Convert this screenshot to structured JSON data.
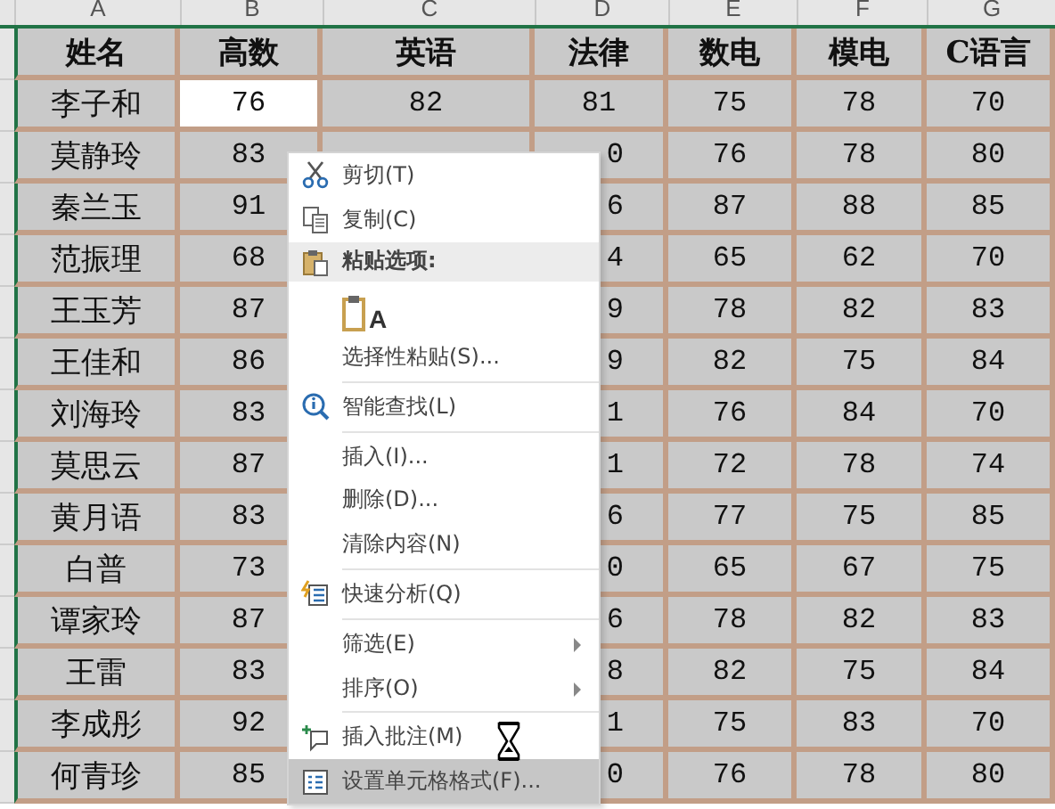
{
  "column_letters": [
    "A",
    "B",
    "C",
    "D",
    "E",
    "F",
    "G"
  ],
  "table": {
    "header": [
      "姓名",
      "高数",
      "英语",
      "法律",
      "数电",
      "模电",
      "C语言"
    ],
    "rows": [
      {
        "cells": [
          {
            "text": "李子和",
            "selected": false
          },
          {
            "text": "76",
            "selected": true
          },
          {
            "text": "82",
            "selected": false
          },
          {
            "text": "81",
            "selected": false
          },
          {
            "text": "75",
            "selected": false
          },
          {
            "text": "78",
            "selected": false
          },
          {
            "text": "70",
            "selected": false
          }
        ]
      },
      {
        "cells": [
          {
            "text": "莫静玲",
            "selected": false
          },
          {
            "text": "83",
            "selected": false
          },
          {
            "text": "",
            "selected": false
          },
          {
            "text": "0",
            "selected": false
          },
          {
            "text": "76",
            "selected": false
          },
          {
            "text": "78",
            "selected": false
          },
          {
            "text": "80",
            "selected": false
          }
        ]
      },
      {
        "cells": [
          {
            "text": "秦兰玉",
            "selected": false
          },
          {
            "text": "91",
            "selected": false
          },
          {
            "text": ""
          },
          {
            "text": "6",
            "selected": false
          },
          {
            "text": "87",
            "selected": false
          },
          {
            "text": "88",
            "selected": false
          },
          {
            "text": "85",
            "selected": false
          }
        ]
      },
      {
        "cells": [
          {
            "text": "范振理",
            "selected": false
          },
          {
            "text": "68",
            "selected": false
          },
          {
            "text": ""
          },
          {
            "text": "4",
            "selected": false
          },
          {
            "text": "65",
            "selected": false
          },
          {
            "text": "62",
            "selected": false
          },
          {
            "text": "70",
            "selected": false
          }
        ]
      },
      {
        "cells": [
          {
            "text": "王玉芳",
            "selected": false
          },
          {
            "text": "87",
            "selected": false
          },
          {
            "text": ""
          },
          {
            "text": "9",
            "selected": false
          },
          {
            "text": "78",
            "selected": false
          },
          {
            "text": "82",
            "selected": false
          },
          {
            "text": "83",
            "selected": false
          }
        ]
      },
      {
        "cells": [
          {
            "text": "王佳和",
            "selected": false
          },
          {
            "text": "86",
            "selected": false
          },
          {
            "text": ""
          },
          {
            "text": "9",
            "selected": false
          },
          {
            "text": "82",
            "selected": false
          },
          {
            "text": "75",
            "selected": false
          },
          {
            "text": "84",
            "selected": false
          }
        ]
      },
      {
        "cells": [
          {
            "text": "刘海玲",
            "selected": false
          },
          {
            "text": "83",
            "selected": false
          },
          {
            "text": ""
          },
          {
            "text": "1",
            "selected": false
          },
          {
            "text": "76",
            "selected": false
          },
          {
            "text": "84",
            "selected": false
          },
          {
            "text": "70",
            "selected": false
          }
        ]
      },
      {
        "cells": [
          {
            "text": "莫思云",
            "selected": false
          },
          {
            "text": "87",
            "selected": false
          },
          {
            "text": ""
          },
          {
            "text": "1",
            "selected": false
          },
          {
            "text": "72",
            "selected": false
          },
          {
            "text": "78",
            "selected": false
          },
          {
            "text": "74",
            "selected": false
          }
        ]
      },
      {
        "cells": [
          {
            "text": "黄月语",
            "selected": false
          },
          {
            "text": "83",
            "selected": false
          },
          {
            "text": ""
          },
          {
            "text": "6",
            "selected": false
          },
          {
            "text": "77",
            "selected": false
          },
          {
            "text": "75",
            "selected": false
          },
          {
            "text": "85",
            "selected": false
          }
        ]
      },
      {
        "cells": [
          {
            "text": "白普",
            "selected": false
          },
          {
            "text": "73",
            "selected": false
          },
          {
            "text": ""
          },
          {
            "text": "0",
            "selected": false
          },
          {
            "text": "65",
            "selected": false
          },
          {
            "text": "67",
            "selected": false
          },
          {
            "text": "75",
            "selected": false
          }
        ]
      },
      {
        "cells": [
          {
            "text": "谭家玲",
            "selected": false
          },
          {
            "text": "87",
            "selected": false
          },
          {
            "text": ""
          },
          {
            "text": "6",
            "selected": false
          },
          {
            "text": "78",
            "selected": false
          },
          {
            "text": "82",
            "selected": false
          },
          {
            "text": "83",
            "selected": false
          }
        ]
      },
      {
        "cells": [
          {
            "text": "王雷",
            "selected": false
          },
          {
            "text": "83",
            "selected": false
          },
          {
            "text": ""
          },
          {
            "text": "8",
            "selected": false
          },
          {
            "text": "82",
            "selected": false
          },
          {
            "text": "75",
            "selected": false
          },
          {
            "text": "84",
            "selected": false
          }
        ]
      },
      {
        "cells": [
          {
            "text": "李成彤",
            "selected": false
          },
          {
            "text": "92",
            "selected": false
          },
          {
            "text": ""
          },
          {
            "text": "1",
            "selected": false
          },
          {
            "text": "75",
            "selected": false
          },
          {
            "text": "83",
            "selected": false
          },
          {
            "text": "70",
            "selected": false
          }
        ]
      },
      {
        "cells": [
          {
            "text": "何青珍",
            "selected": false
          },
          {
            "text": "85",
            "selected": false
          },
          {
            "text": ""
          },
          {
            "text": "0",
            "selected": false
          },
          {
            "text": "76",
            "selected": false
          },
          {
            "text": "78",
            "selected": false
          },
          {
            "text": "80",
            "selected": false
          }
        ]
      }
    ]
  },
  "context_menu": {
    "items": [
      {
        "kind": "item",
        "label": "剪切(T)",
        "submenu": false,
        "selected": false
      },
      {
        "kind": "item",
        "label": "复制(C)",
        "submenu": false,
        "selected": false
      },
      {
        "kind": "header",
        "label": "粘贴选项:"
      },
      {
        "kind": "paste-option",
        "letter": "A"
      },
      {
        "kind": "item",
        "label": "选择性粘贴(S)...",
        "submenu": false,
        "selected": false
      },
      {
        "kind": "separator"
      },
      {
        "kind": "item",
        "label": "智能查找(L)",
        "submenu": false,
        "selected": false
      },
      {
        "kind": "separator"
      },
      {
        "kind": "item",
        "label": "插入(I)...",
        "submenu": false,
        "selected": false
      },
      {
        "kind": "item",
        "label": "删除(D)...",
        "submenu": false,
        "selected": false
      },
      {
        "kind": "item",
        "label": "清除内容(N)",
        "submenu": false,
        "selected": false
      },
      {
        "kind": "separator"
      },
      {
        "kind": "item",
        "label": "快速分析(Q)",
        "submenu": false,
        "selected": false
      },
      {
        "kind": "separator"
      },
      {
        "kind": "item",
        "label": "筛选(E)",
        "submenu": true,
        "selected": false
      },
      {
        "kind": "item",
        "label": "排序(O)",
        "submenu": true,
        "selected": false
      },
      {
        "kind": "separator"
      },
      {
        "kind": "item",
        "label": "插入批注(M)",
        "submenu": false,
        "selected": false
      },
      {
        "kind": "item",
        "label": "设置单元格格式(F)...",
        "submenu": false,
        "selected": true
      }
    ]
  }
}
